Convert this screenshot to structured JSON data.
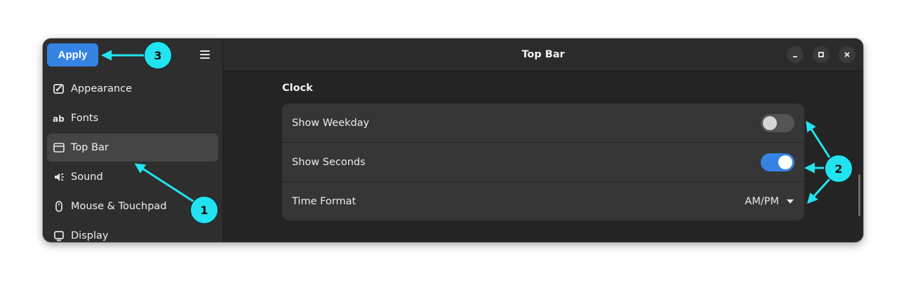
{
  "window": {
    "title": "Top Bar",
    "controls": [
      "minimize",
      "maximize",
      "close"
    ]
  },
  "sidebar": {
    "apply_label": "Apply",
    "items": [
      {
        "label": "Appearance",
        "icon": "appearance-icon",
        "active": false
      },
      {
        "label": "Fonts",
        "icon": "fonts-icon",
        "active": false
      },
      {
        "label": "Top Bar",
        "icon": "top-bar-icon",
        "active": true
      },
      {
        "label": "Sound",
        "icon": "sound-icon",
        "active": false
      },
      {
        "label": "Mouse & Touchpad",
        "icon": "mouse-icon",
        "active": false
      },
      {
        "label": "Display",
        "icon": "display-icon",
        "active": false
      }
    ]
  },
  "clock": {
    "section_title": "Clock",
    "rows": [
      {
        "label": "Show Weekday",
        "control": "switch",
        "on": false
      },
      {
        "label": "Show Seconds",
        "control": "switch",
        "on": true
      },
      {
        "label": "Time Format",
        "control": "dropdown",
        "value": "AM/PM"
      }
    ]
  },
  "annotations": {
    "badge_1": "1",
    "badge_2": "2",
    "badge_3": "3",
    "color": "#22e3f0"
  },
  "colors": {
    "accent": "#3584e4",
    "window_bg": "#242424",
    "sidebar_bg": "#2e2e2e",
    "card_bg": "#363636"
  }
}
